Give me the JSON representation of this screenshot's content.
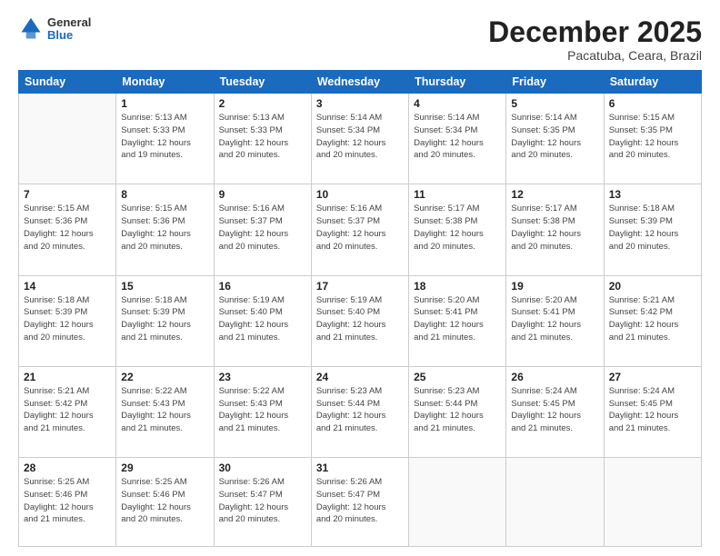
{
  "header": {
    "logo_general": "General",
    "logo_blue": "Blue",
    "main_title": "December 2025",
    "subtitle": "Pacatuba, Ceara, Brazil"
  },
  "days_of_week": [
    "Sunday",
    "Monday",
    "Tuesday",
    "Wednesday",
    "Thursday",
    "Friday",
    "Saturday"
  ],
  "weeks": [
    [
      {
        "day": "",
        "info": ""
      },
      {
        "day": "1",
        "info": "Sunrise: 5:13 AM\nSunset: 5:33 PM\nDaylight: 12 hours\nand 19 minutes."
      },
      {
        "day": "2",
        "info": "Sunrise: 5:13 AM\nSunset: 5:33 PM\nDaylight: 12 hours\nand 20 minutes."
      },
      {
        "day": "3",
        "info": "Sunrise: 5:14 AM\nSunset: 5:34 PM\nDaylight: 12 hours\nand 20 minutes."
      },
      {
        "day": "4",
        "info": "Sunrise: 5:14 AM\nSunset: 5:34 PM\nDaylight: 12 hours\nand 20 minutes."
      },
      {
        "day": "5",
        "info": "Sunrise: 5:14 AM\nSunset: 5:35 PM\nDaylight: 12 hours\nand 20 minutes."
      },
      {
        "day": "6",
        "info": "Sunrise: 5:15 AM\nSunset: 5:35 PM\nDaylight: 12 hours\nand 20 minutes."
      }
    ],
    [
      {
        "day": "7",
        "info": "Sunrise: 5:15 AM\nSunset: 5:36 PM\nDaylight: 12 hours\nand 20 minutes."
      },
      {
        "day": "8",
        "info": "Sunrise: 5:15 AM\nSunset: 5:36 PM\nDaylight: 12 hours\nand 20 minutes."
      },
      {
        "day": "9",
        "info": "Sunrise: 5:16 AM\nSunset: 5:37 PM\nDaylight: 12 hours\nand 20 minutes."
      },
      {
        "day": "10",
        "info": "Sunrise: 5:16 AM\nSunset: 5:37 PM\nDaylight: 12 hours\nand 20 minutes."
      },
      {
        "day": "11",
        "info": "Sunrise: 5:17 AM\nSunset: 5:38 PM\nDaylight: 12 hours\nand 20 minutes."
      },
      {
        "day": "12",
        "info": "Sunrise: 5:17 AM\nSunset: 5:38 PM\nDaylight: 12 hours\nand 20 minutes."
      },
      {
        "day": "13",
        "info": "Sunrise: 5:18 AM\nSunset: 5:39 PM\nDaylight: 12 hours\nand 20 minutes."
      }
    ],
    [
      {
        "day": "14",
        "info": "Sunrise: 5:18 AM\nSunset: 5:39 PM\nDaylight: 12 hours\nand 20 minutes."
      },
      {
        "day": "15",
        "info": "Sunrise: 5:18 AM\nSunset: 5:39 PM\nDaylight: 12 hours\nand 21 minutes."
      },
      {
        "day": "16",
        "info": "Sunrise: 5:19 AM\nSunset: 5:40 PM\nDaylight: 12 hours\nand 21 minutes."
      },
      {
        "day": "17",
        "info": "Sunrise: 5:19 AM\nSunset: 5:40 PM\nDaylight: 12 hours\nand 21 minutes."
      },
      {
        "day": "18",
        "info": "Sunrise: 5:20 AM\nSunset: 5:41 PM\nDaylight: 12 hours\nand 21 minutes."
      },
      {
        "day": "19",
        "info": "Sunrise: 5:20 AM\nSunset: 5:41 PM\nDaylight: 12 hours\nand 21 minutes."
      },
      {
        "day": "20",
        "info": "Sunrise: 5:21 AM\nSunset: 5:42 PM\nDaylight: 12 hours\nand 21 minutes."
      }
    ],
    [
      {
        "day": "21",
        "info": "Sunrise: 5:21 AM\nSunset: 5:42 PM\nDaylight: 12 hours\nand 21 minutes."
      },
      {
        "day": "22",
        "info": "Sunrise: 5:22 AM\nSunset: 5:43 PM\nDaylight: 12 hours\nand 21 minutes."
      },
      {
        "day": "23",
        "info": "Sunrise: 5:22 AM\nSunset: 5:43 PM\nDaylight: 12 hours\nand 21 minutes."
      },
      {
        "day": "24",
        "info": "Sunrise: 5:23 AM\nSunset: 5:44 PM\nDaylight: 12 hours\nand 21 minutes."
      },
      {
        "day": "25",
        "info": "Sunrise: 5:23 AM\nSunset: 5:44 PM\nDaylight: 12 hours\nand 21 minutes."
      },
      {
        "day": "26",
        "info": "Sunrise: 5:24 AM\nSunset: 5:45 PM\nDaylight: 12 hours\nand 21 minutes."
      },
      {
        "day": "27",
        "info": "Sunrise: 5:24 AM\nSunset: 5:45 PM\nDaylight: 12 hours\nand 21 minutes."
      }
    ],
    [
      {
        "day": "28",
        "info": "Sunrise: 5:25 AM\nSunset: 5:46 PM\nDaylight: 12 hours\nand 21 minutes."
      },
      {
        "day": "29",
        "info": "Sunrise: 5:25 AM\nSunset: 5:46 PM\nDaylight: 12 hours\nand 20 minutes."
      },
      {
        "day": "30",
        "info": "Sunrise: 5:26 AM\nSunset: 5:47 PM\nDaylight: 12 hours\nand 20 minutes."
      },
      {
        "day": "31",
        "info": "Sunrise: 5:26 AM\nSunset: 5:47 PM\nDaylight: 12 hours\nand 20 minutes."
      },
      {
        "day": "",
        "info": ""
      },
      {
        "day": "",
        "info": ""
      },
      {
        "day": "",
        "info": ""
      }
    ]
  ]
}
